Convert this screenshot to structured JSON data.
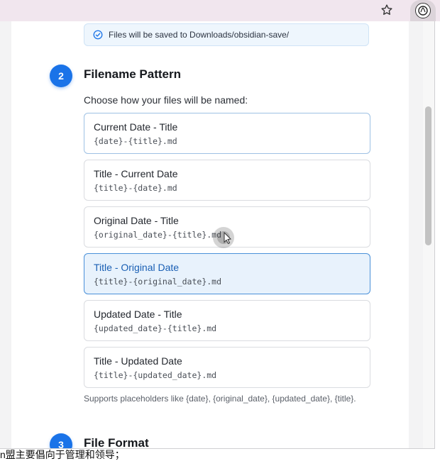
{
  "browser": {
    "bookmark_icon": "star-icon",
    "extension_icon": "obsidian-extension-icon"
  },
  "info": {
    "icon": "check-circle-icon",
    "text": "Files will be saved to Downloads/obsidian-save/"
  },
  "section2": {
    "step": "2",
    "title": "Filename Pattern",
    "subtitle": "Choose how your files will be named:",
    "options": [
      {
        "label": "Current Date - Title",
        "pattern": "{date}-{title}.md"
      },
      {
        "label": "Title - Current Date",
        "pattern": "{title}-{date}.md"
      },
      {
        "label": "Original Date - Title",
        "pattern": "{original_date}-{title}.md"
      },
      {
        "label": "Title - Original Date",
        "pattern": "{title}-{original_date}.md"
      },
      {
        "label": "Updated Date - Title",
        "pattern": "{updated_date}-{title}.md"
      },
      {
        "label": "Title - Updated Date",
        "pattern": "{title}-{updated_date}.md"
      }
    ],
    "selected_index": 3,
    "helper": "Supports placeholders like {date}, {original_date}, {updated_date}, {title}."
  },
  "section3": {
    "step": "3",
    "title": "File Format"
  },
  "background_text": "n盟主要倡向于管理和领导；",
  "colors": {
    "accent": "#1a73e8",
    "selected_bg": "#e8f2fc",
    "selected_border": "#4a90d9",
    "info_bg": "#eef6fd"
  }
}
